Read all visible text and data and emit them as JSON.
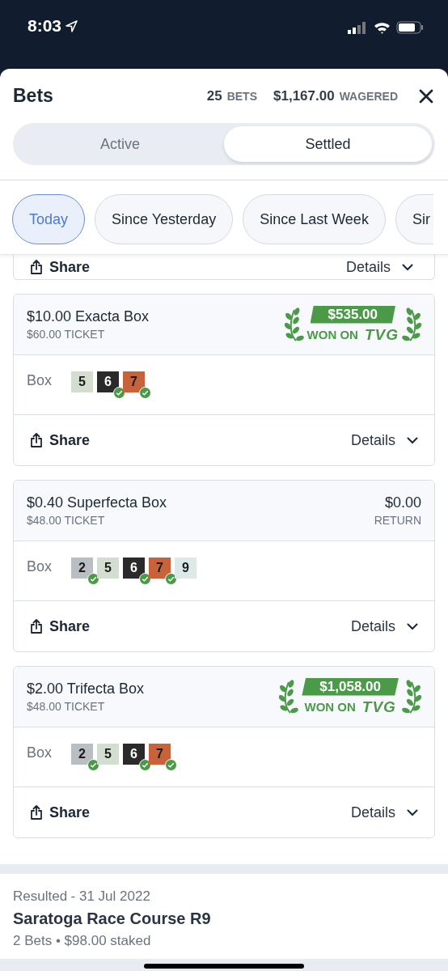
{
  "status_bar": {
    "time": "8:03"
  },
  "header": {
    "title": "Bets",
    "bet_count": "25",
    "bet_count_label": "BETS",
    "wagered": "$1,167.00",
    "wagered_label": "WAGERED"
  },
  "tabs": [
    {
      "label": "Active",
      "selected": false
    },
    {
      "label": "Settled",
      "selected": true
    }
  ],
  "filters": [
    {
      "label": "Today",
      "selected": true
    },
    {
      "label": "Since Yesterday",
      "selected": false
    },
    {
      "label": "Since Last Week",
      "selected": false
    },
    {
      "label": "Sir",
      "selected": false
    }
  ],
  "partial_card": {
    "share": "Share",
    "details": "Details"
  },
  "bets": [
    {
      "title": "$10.00 Exacta Box",
      "ticket": "$60.00 TICKET",
      "result": {
        "kind": "won",
        "amount": "$535.00",
        "label": "WON ON",
        "brand": "TVG"
      },
      "selection_label": "Box",
      "runners": [
        {
          "number": "5",
          "color": "#d3ddd0",
          "checked": false
        },
        {
          "number": "6",
          "color": "#2a2a2a",
          "checked": true
        },
        {
          "number": "7",
          "color": "#c8623a",
          "checked": true
        }
      ],
      "share": "Share",
      "details": "Details"
    },
    {
      "title": "$0.40 Superfecta Box",
      "ticket": "$48.00 TICKET",
      "result": {
        "kind": "return",
        "amount": "$0.00",
        "label": "RETURN"
      },
      "selection_label": "Box",
      "runners": [
        {
          "number": "2",
          "color": "#b9bec3",
          "checked": true
        },
        {
          "number": "5",
          "color": "#d3ddd0",
          "checked": false
        },
        {
          "number": "6",
          "color": "#2a2a2a",
          "checked": true
        },
        {
          "number": "7",
          "color": "#c8623a",
          "checked": true
        },
        {
          "number": "9",
          "color": "#dce9e6",
          "checked": false
        }
      ],
      "share": "Share",
      "details": "Details"
    },
    {
      "title": "$2.00 Trifecta Box",
      "ticket": "$48.00 TICKET",
      "result": {
        "kind": "won",
        "amount": "$1,058.00",
        "label": "WON ON",
        "brand": "TVG"
      },
      "selection_label": "Box",
      "runners": [
        {
          "number": "2",
          "color": "#b9bec3",
          "checked": true
        },
        {
          "number": "5",
          "color": "#d3ddd0",
          "checked": false
        },
        {
          "number": "6",
          "color": "#2a2a2a",
          "checked": true
        },
        {
          "number": "7",
          "color": "#c8623a",
          "checked": true
        }
      ],
      "share": "Share",
      "details": "Details"
    }
  ],
  "race": {
    "status": "Resulted",
    "date": "- 31 Jul 2022",
    "name": "Saratoga Race Course R9",
    "summary": "2 Bets • $98.00 staked"
  }
}
